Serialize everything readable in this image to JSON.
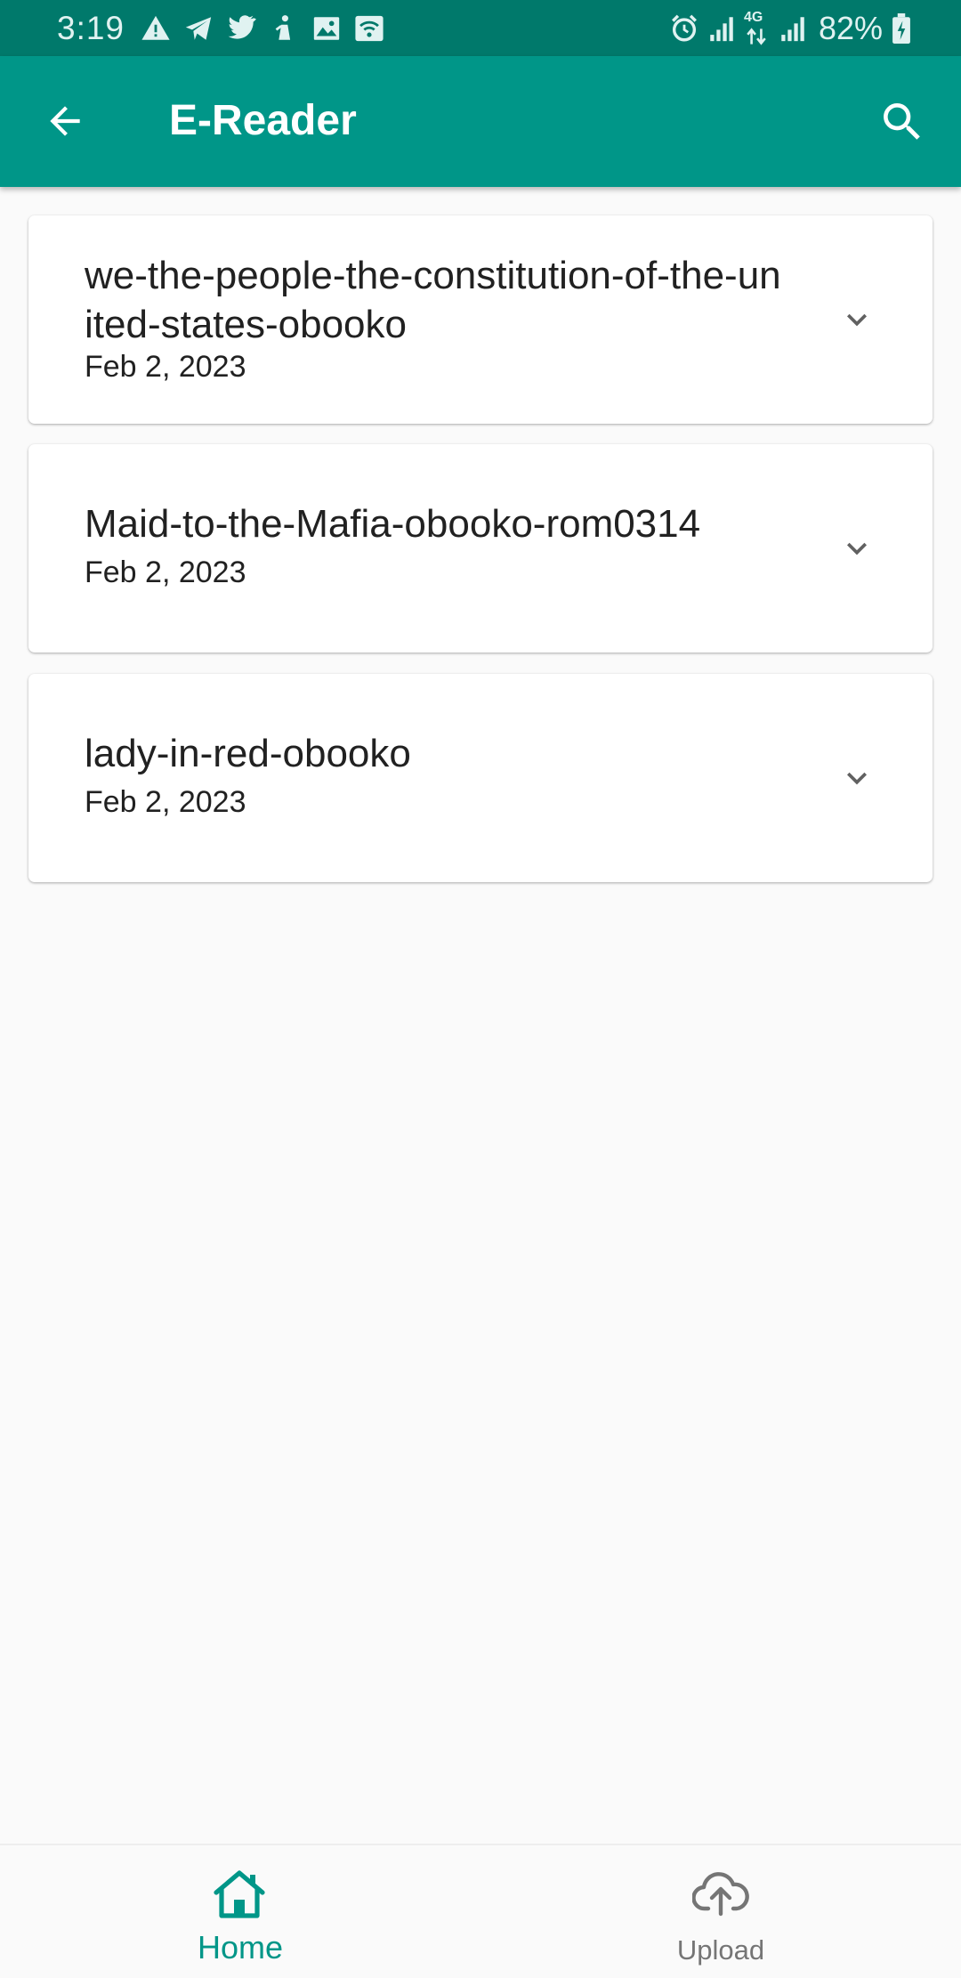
{
  "status_bar": {
    "time": "3:19",
    "battery": "82%",
    "network": "4G",
    "left_icons": [
      "warning-icon",
      "telegram-icon",
      "twitter-icon",
      "app-icon",
      "image-icon",
      "wifi-hotspot-icon"
    ],
    "right_icons": [
      "alarm-icon",
      "signal-icon",
      "data-arrows-icon",
      "signal-icon",
      "battery-charging-icon"
    ]
  },
  "app_bar": {
    "title": "E-Reader",
    "back_icon": "arrow-back-icon",
    "search_icon": "search-icon",
    "color": "#009688"
  },
  "books": [
    {
      "title": "we-the-people-the-constitution-of-the-united-states-obooko",
      "date": "Feb 2, 2023"
    },
    {
      "title": "Maid-to-the-Mafia-obooko-rom0314",
      "date": "Feb 2, 2023"
    },
    {
      "title": "lady-in-red-obooko",
      "date": "Feb 2, 2023"
    }
  ],
  "bottom_nav": {
    "home_label": "Home",
    "upload_label": "Upload",
    "active": "Home",
    "active_color": "#009688",
    "inactive_color": "#757575"
  }
}
